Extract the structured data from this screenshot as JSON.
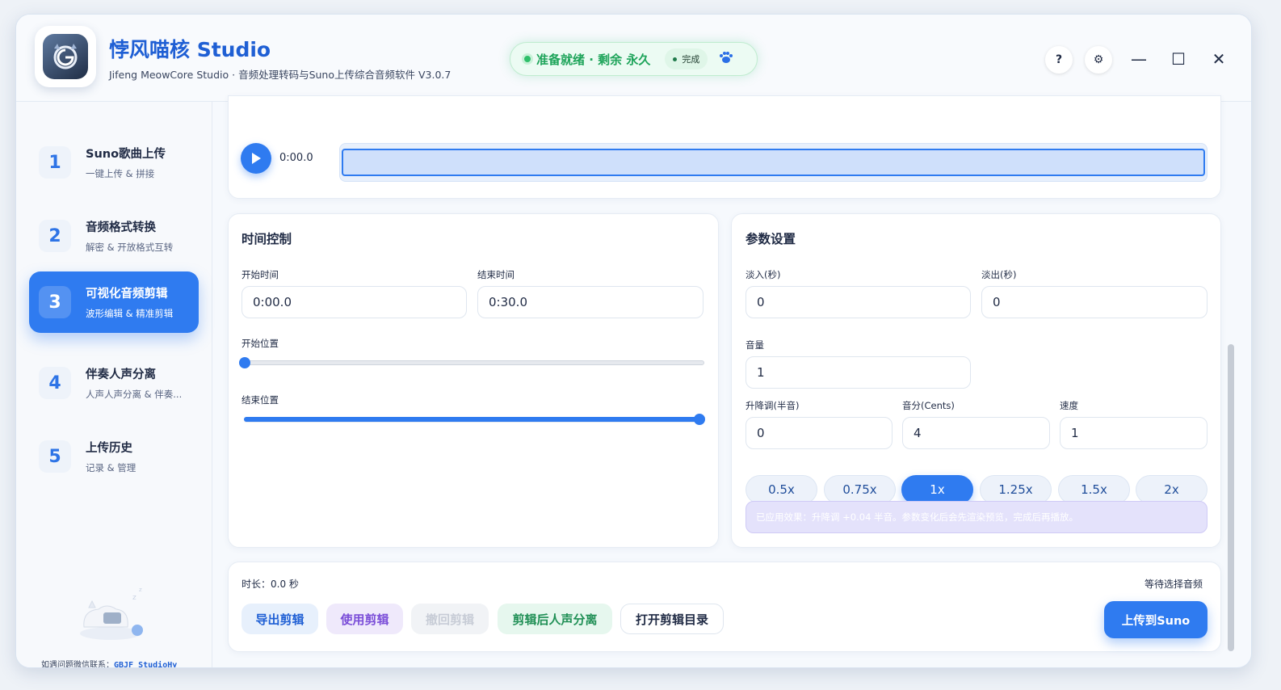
{
  "header": {
    "title": "悖风喵核 Studio",
    "subtitle": "Jifeng MeowCore Studio · 音频处理转码与Suno上传综合音频软件 V3.0.7",
    "status_text": "准备就绪 · 剩余 永久",
    "status_chip": "完成",
    "help_label": "?",
    "settings_label": "⚙",
    "minimize_label": "—",
    "maximize_label": "☐",
    "close_label": "✕"
  },
  "sidebar": {
    "items": [
      {
        "num": "1",
        "title": "Suno歌曲上传",
        "sub": "一键上传 & 拼接"
      },
      {
        "num": "2",
        "title": "音频格式转换",
        "sub": "解密 & 开放格式互转"
      },
      {
        "num": "3",
        "title": "可视化音频剪辑",
        "sub": "波形编辑 & 精准剪辑"
      },
      {
        "num": "4",
        "title": "伴奏人声分离",
        "sub": "人声人声分离 & 伴奏..."
      },
      {
        "num": "5",
        "title": "上传历史",
        "sub": "记录 & 管理"
      }
    ],
    "active_index": 2,
    "contact_label": "如遇问题微信联系：",
    "contact_id": "GBJF_StudioHy"
  },
  "player": {
    "time": "0:00.0"
  },
  "time_control": {
    "title": "时间控制",
    "start_label": "开始时间",
    "start_value": "0:00.0",
    "end_label": "结束时间",
    "end_value": "0:30.0",
    "start_pos_label": "开始位置",
    "start_pos_fraction": 0.0,
    "end_pos_label": "结束位置",
    "end_pos_fraction": 1.0
  },
  "params": {
    "title": "参数设置",
    "fade_in_label": "淡入(秒)",
    "fade_in_value": "0",
    "fade_out_label": "淡出(秒)",
    "fade_out_value": "0",
    "volume_label": "音量",
    "volume_value": "1",
    "pitch_label": "升降调(半音)",
    "pitch_value": "0",
    "cents_label": "音分(Cents)",
    "cents_value": "4",
    "speed_label": "速度",
    "speed_value": "1",
    "speed_options": [
      "0.5x",
      "0.75x",
      "1x",
      "1.25x",
      "1.5x",
      "2x"
    ],
    "speed_selected": "1x",
    "effect_note": "已应用效果：升降调 +0.04 半音。参数变化后会先渲染预览，完成后再播放。"
  },
  "footer": {
    "duration": "时长：0.0 秒",
    "status": "等待选择音频",
    "buttons": [
      "导出剪辑",
      "使用剪辑",
      "撤回剪辑",
      "剪辑后人声分离",
      "打开剪辑目录"
    ],
    "upload_label": "上传到Suno"
  },
  "colors": {
    "accent": "#2f7bf0",
    "status_green": "#1ea45a",
    "effect_bg": "#e4e2fb"
  }
}
